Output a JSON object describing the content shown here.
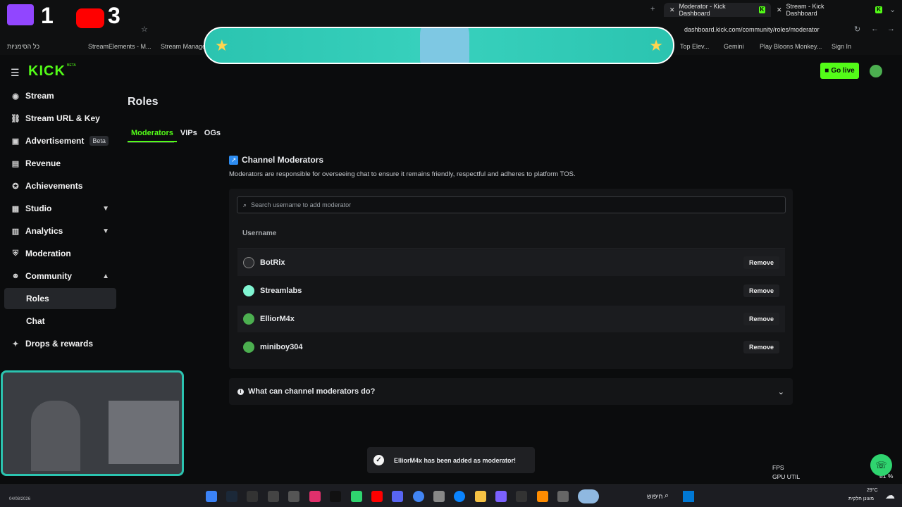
{
  "browser": {
    "tabs": [
      {
        "title": "Moderator - Kick Dashboard",
        "active": true
      },
      {
        "title": "Stream - Kick Dashboard",
        "active": false
      }
    ],
    "url": "dashboard.kick.com/community/roles/moderator",
    "bookmarks": [
      "כל הסימניות",
      "StreamElements - M...",
      "Stream Manager",
      "Top Elev...",
      "Gemini",
      "Play Bloons Monkey...",
      "Sign In"
    ]
  },
  "overlay": {
    "counter_a": "1",
    "counter_b": "3"
  },
  "header": {
    "logo": "KICK",
    "logo_beta": "BETA",
    "go_live_label": "Go live"
  },
  "sidebar": {
    "items": [
      {
        "label": "Stream",
        "icon": "broadcast-icon"
      },
      {
        "label": "Stream URL & Key",
        "icon": "link-icon"
      },
      {
        "label": "Advertisement",
        "icon": "ad-icon",
        "badge": "Beta"
      },
      {
        "label": "Revenue",
        "icon": "revenue-icon"
      },
      {
        "label": "Achievements",
        "icon": "trophy-icon"
      },
      {
        "label": "Studio",
        "icon": "studio-icon",
        "expandable": true
      },
      {
        "label": "Analytics",
        "icon": "analytics-icon",
        "expandable": true
      },
      {
        "label": "Moderation",
        "icon": "moderation-icon"
      },
      {
        "label": "Community",
        "icon": "community-icon",
        "expanded": true
      },
      {
        "label": "Roles",
        "sub": true,
        "selected": true
      },
      {
        "label": "Chat",
        "sub": true
      },
      {
        "label": "Drops & rewards",
        "icon": "gift-icon"
      }
    ]
  },
  "page": {
    "title": "Roles",
    "tabs": [
      {
        "label": "Moderators",
        "active": true
      },
      {
        "label": "VIPs"
      },
      {
        "label": "OGs"
      }
    ],
    "section_title": "Channel Moderators",
    "section_desc": "Moderators are responsible for overseeing chat to ensure it remains friendly, respectful and adheres to platform TOS.",
    "search_placeholder": "Search username to add moderator",
    "column_header": "Username",
    "moderators": [
      {
        "name": "BotRix",
        "avatar_color": "#2a2b2e",
        "action": "Remove"
      },
      {
        "name": "Streamlabs",
        "avatar_color": "#80f5d2",
        "action": "Remove"
      },
      {
        "name": "ElliorM4x",
        "avatar_color": "#4caf50",
        "action": "Remove"
      },
      {
        "name": "miniboy304",
        "avatar_color": "#4caf50",
        "action": "Remove"
      }
    ],
    "faq_label": "What can channel moderators do?"
  },
  "toast": {
    "message": "ElliorM4x has been added as moderator!"
  },
  "stats": {
    "fps_label": "FPS",
    "gpu_label": "GPU UTIL",
    "gpu_value": "81 %"
  },
  "taskbar": {
    "search_label": "חיפוש",
    "date": "04/08/2026",
    "weather": "29°C",
    "weather_desc": "מעונן חלקית"
  },
  "colors": {
    "accent": "#53fc18",
    "background": "#0b0c0d",
    "panel": "#141517",
    "banner": "#2bc4b0"
  }
}
